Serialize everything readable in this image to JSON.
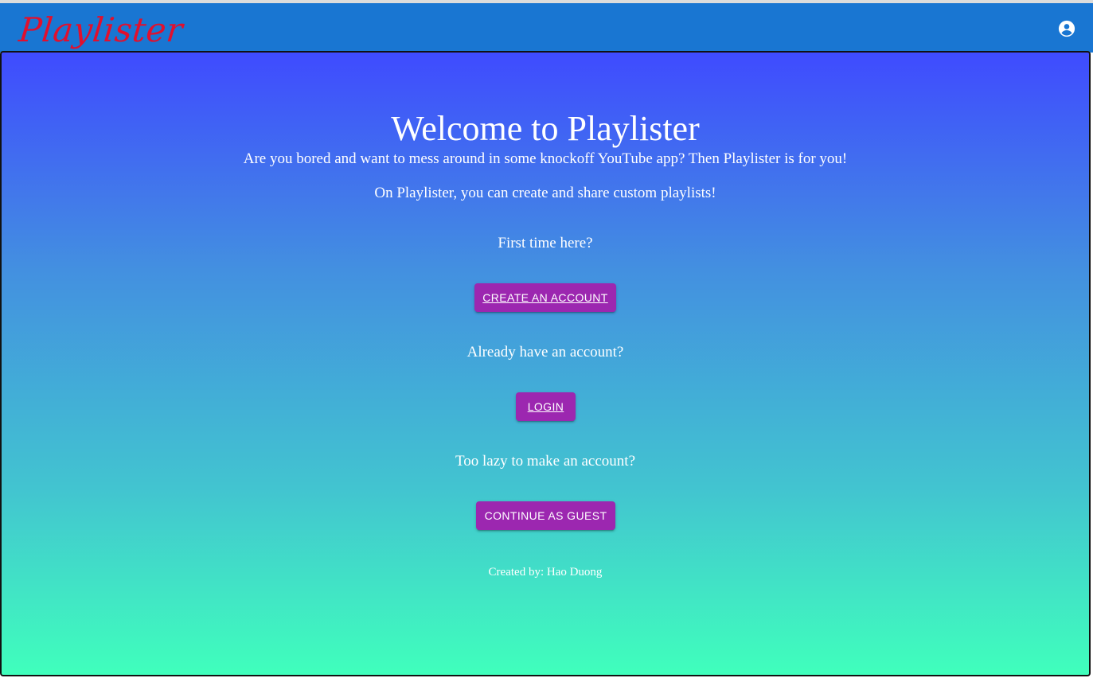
{
  "app": {
    "logo_text": "Playlister",
    "account_icon": "account-circle-icon",
    "colors": {
      "appbar": "#1976d2",
      "logo": "#e0102e",
      "button": "#9c27b0",
      "gradient_top": "#3f4bff",
      "gradient_bottom": "#40ffbc"
    }
  },
  "splash": {
    "title": "Welcome to Playlister",
    "tagline": "Are you bored and want to mess around in some knockoff YouTube app? Then Playlister is for you!",
    "tagline2": "On Playlister, you can create and share custom playlists!",
    "first_time_prompt": "First time here?",
    "create_account_label": "CREATE AN ACCOUNT",
    "already_prompt": "Already have an account?",
    "login_label": "LOGIN",
    "guest_prompt": "Too lazy to make an account?",
    "guest_label": "CONTINUE AS GUEST",
    "credit": "Created by: Hao Duong"
  }
}
